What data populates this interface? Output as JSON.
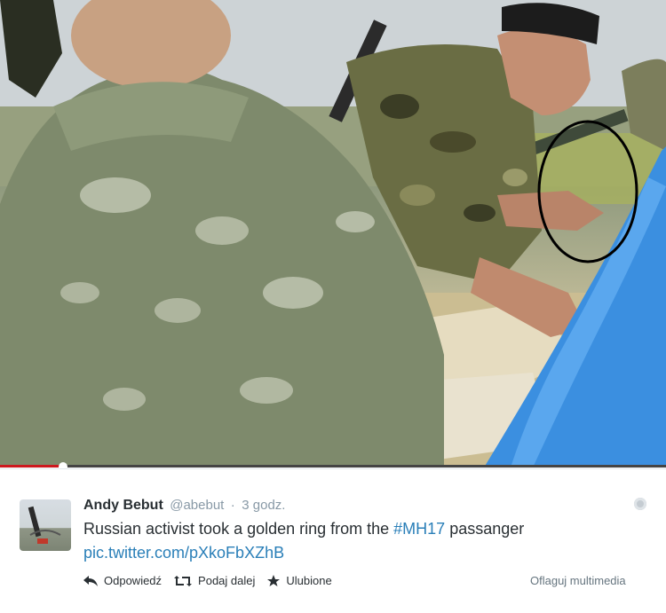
{
  "video": {
    "description_icons": [
      "circled-region-annotation"
    ],
    "progress_fraction": 0.095
  },
  "tweet": {
    "display_name": "Andy Bebut",
    "handle": "@abebut",
    "separator": "·",
    "time": "3 godz.",
    "text_before": "Russian activist took a golden ring from the ",
    "hashtag": "#MH17",
    "text_after": " passanger",
    "link": "pic.twitter.com/pXkoFbXZhB",
    "actions": {
      "reply": "Odpowiedź",
      "retweet": "Podaj dalej",
      "favorite": "Ulubione"
    },
    "flag_media": "Oflaguj multimedia"
  },
  "colors": {
    "link": "#2a7fb8",
    "progress": "#cc181e",
    "text": "#292f33",
    "muted": "#8899a6"
  }
}
